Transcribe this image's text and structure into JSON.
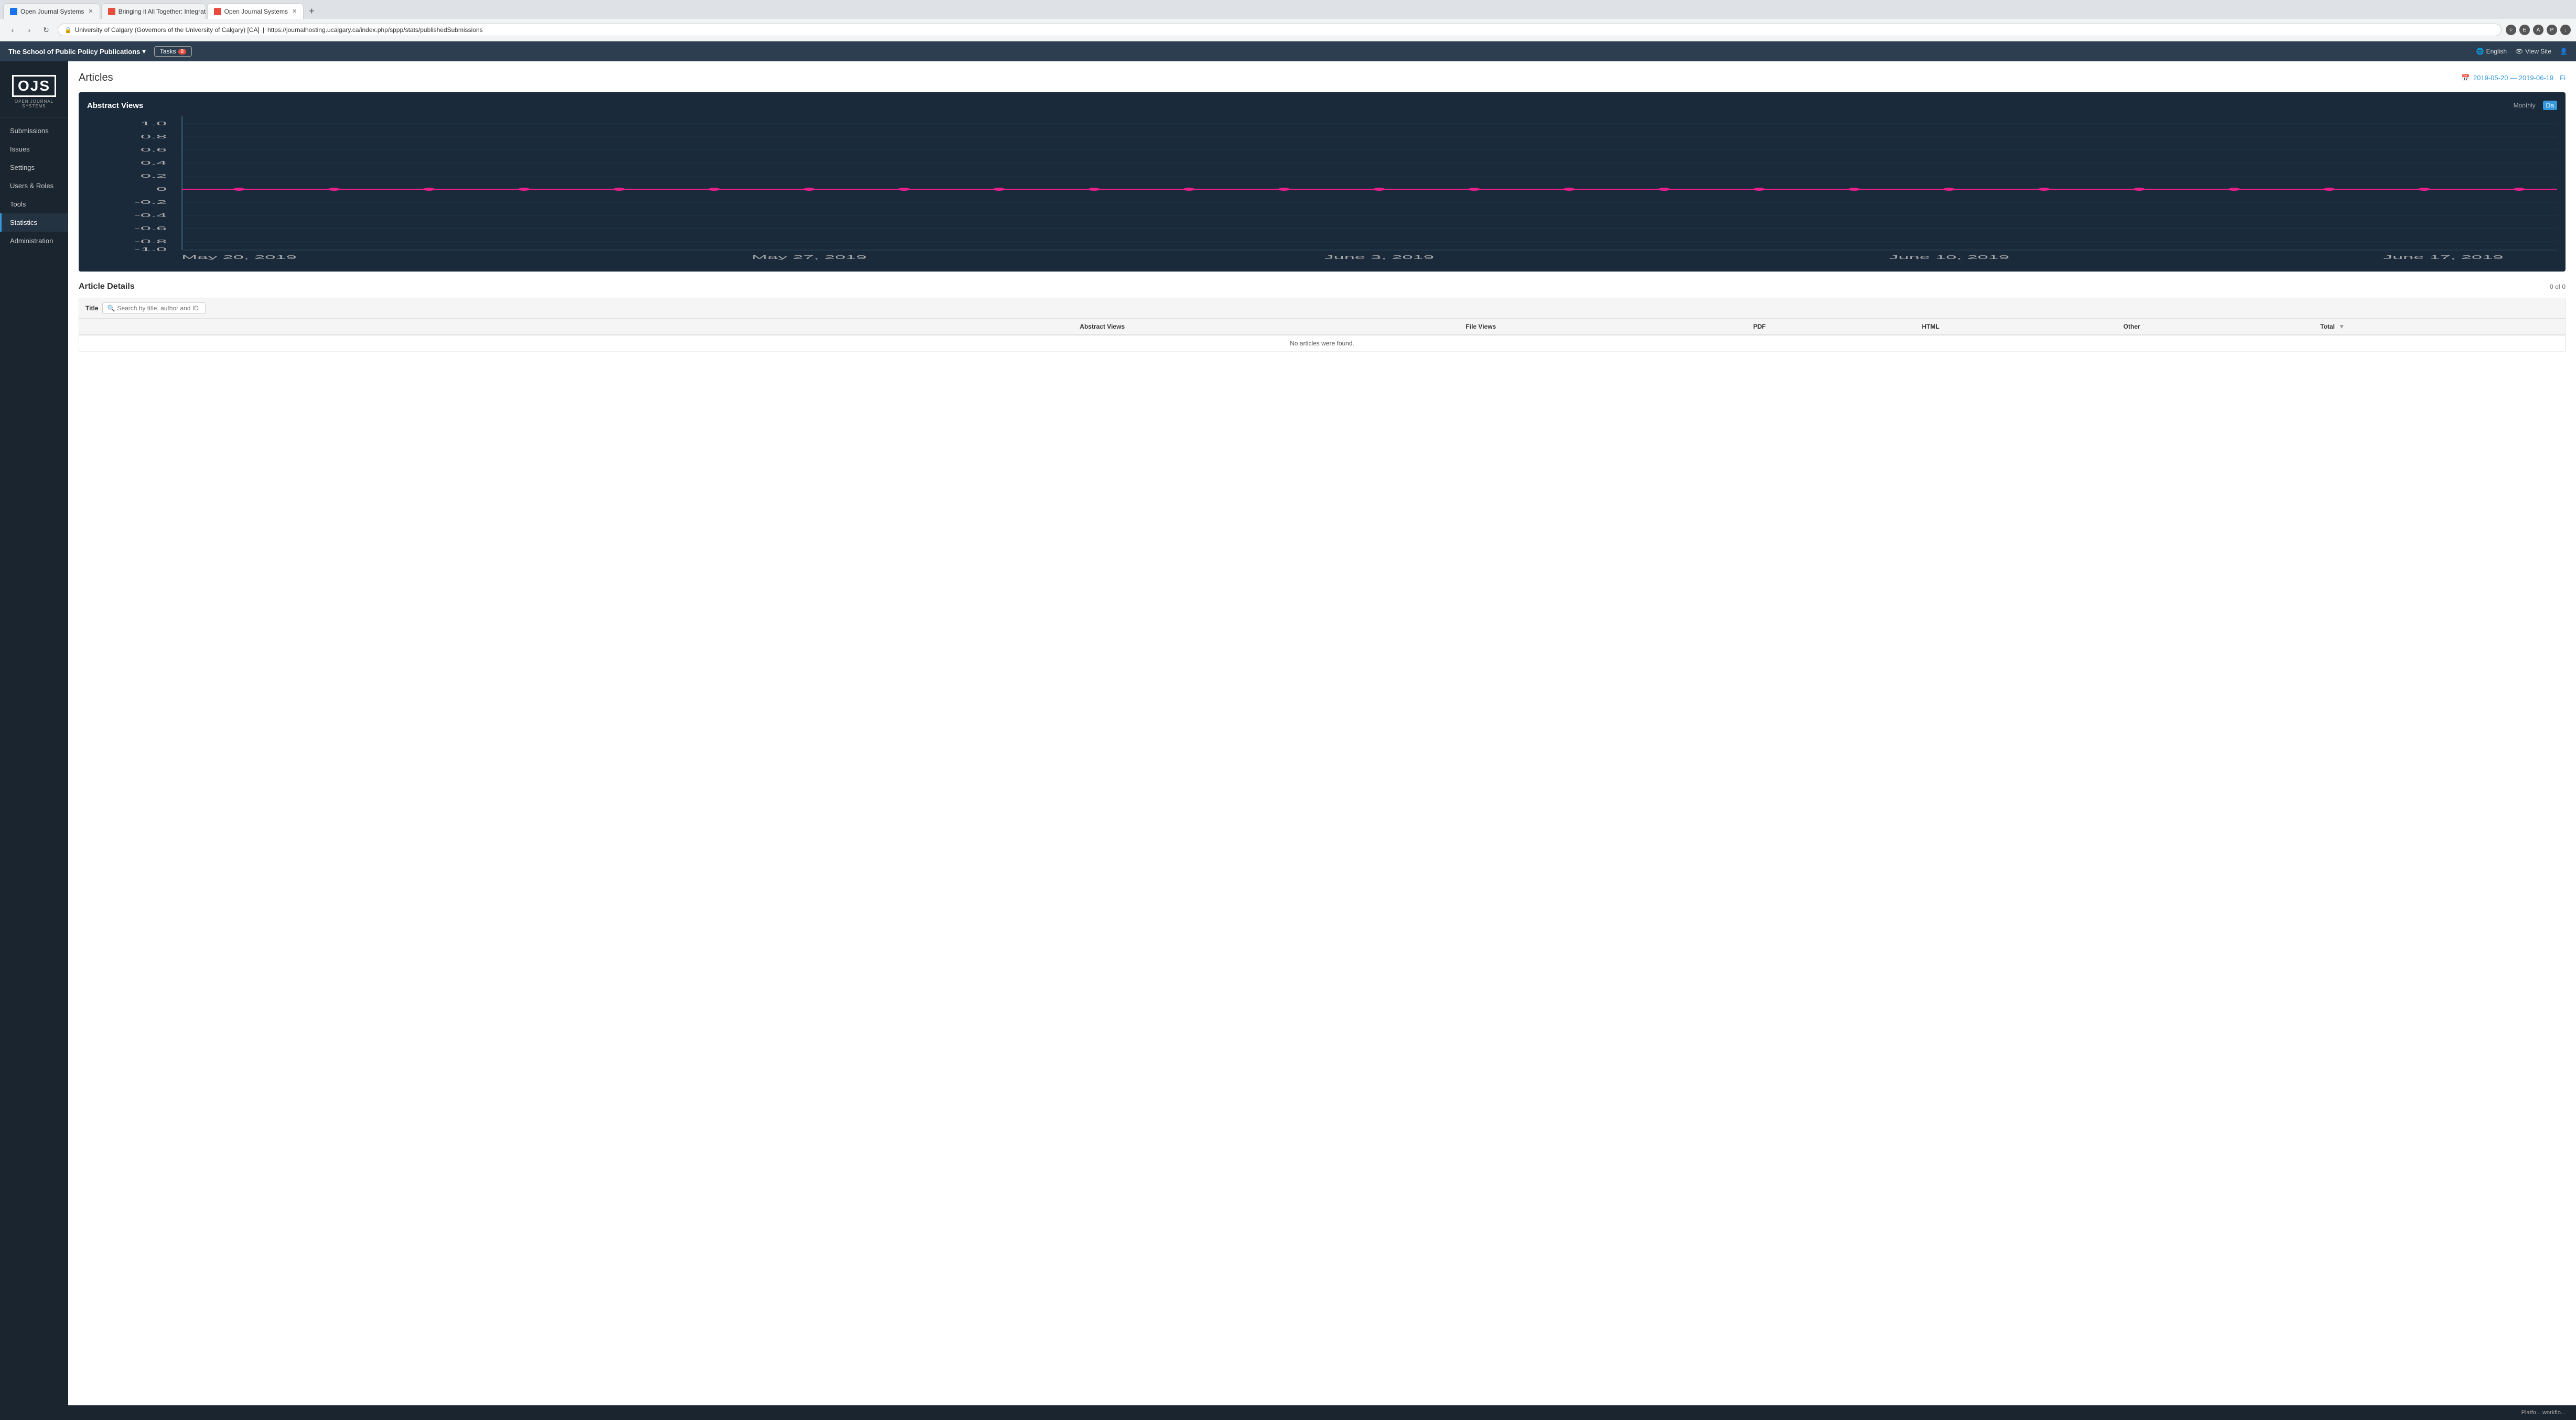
{
  "browser": {
    "tabs": [
      {
        "id": "tab1",
        "favicon_color": "#1a73e8",
        "label": "Open Journal Systems",
        "active": false
      },
      {
        "id": "tab2",
        "favicon_color": "#e74c3c",
        "label": "Bringing it All Together: Integrati",
        "active": false
      },
      {
        "id": "tab3",
        "favicon_color": "#e74c3c",
        "label": "Open Journal Systems",
        "active": true
      }
    ],
    "url": "https://journalhosting.ucalgary.ca/index.php/sppp/stats/publishedSubmissions",
    "url_domain": "University of Calgary (Governors of the University of Calgary) [CA]"
  },
  "app_header": {
    "journal_name": "The School of Public Policy Publications",
    "tasks_label": "Tasks",
    "tasks_count": "8",
    "language_label": "English",
    "view_site_label": "View Site"
  },
  "sidebar": {
    "logo_text": "OJS",
    "logo_subtitle": "OPEN JOURNAL SYSTEMS",
    "items": [
      {
        "id": "submissions",
        "label": "Submissions",
        "active": false
      },
      {
        "id": "issues",
        "label": "Issues",
        "active": false
      },
      {
        "id": "settings",
        "label": "Settings",
        "active": false
      },
      {
        "id": "users-roles",
        "label": "Users & Roles",
        "active": false
      },
      {
        "id": "tools",
        "label": "Tools",
        "active": false
      },
      {
        "id": "statistics",
        "label": "Statistics",
        "active": true
      },
      {
        "id": "administration",
        "label": "Administration",
        "active": false
      }
    ]
  },
  "page": {
    "title": "Articles",
    "date_range": "2019-05-20 — 2019-06-19",
    "filter_label": "Fi"
  },
  "chart": {
    "title": "Abstract Views",
    "toggle_monthly": "Monthly",
    "toggle_daily": "Da",
    "y_labels": [
      "1.0",
      "0.8",
      "0.6",
      "0.4",
      "0.2",
      "0",
      "-0.2",
      "-0.4",
      "-0.6",
      "-0.8",
      "-1.0"
    ],
    "x_labels": [
      "May 20, 2019",
      "May 27, 2019",
      "June 3, 2019",
      "June 10, 2019",
      "June 17, 2019"
    ]
  },
  "article_details": {
    "title": "Article Details",
    "count": "0 of 0",
    "search_placeholder": "Search by title, author and ID",
    "columns": [
      {
        "id": "title",
        "label": "Title"
      },
      {
        "id": "abstract-views",
        "label": "Abstract Views"
      },
      {
        "id": "file-views",
        "label": "File Views"
      },
      {
        "id": "pdf",
        "label": "PDF"
      },
      {
        "id": "html",
        "label": "HTML"
      },
      {
        "id": "other",
        "label": "Other"
      },
      {
        "id": "total",
        "label": "Total"
      }
    ],
    "empty_message": "No articles were found."
  },
  "footer": {
    "text": "Platfo... workflo..."
  }
}
